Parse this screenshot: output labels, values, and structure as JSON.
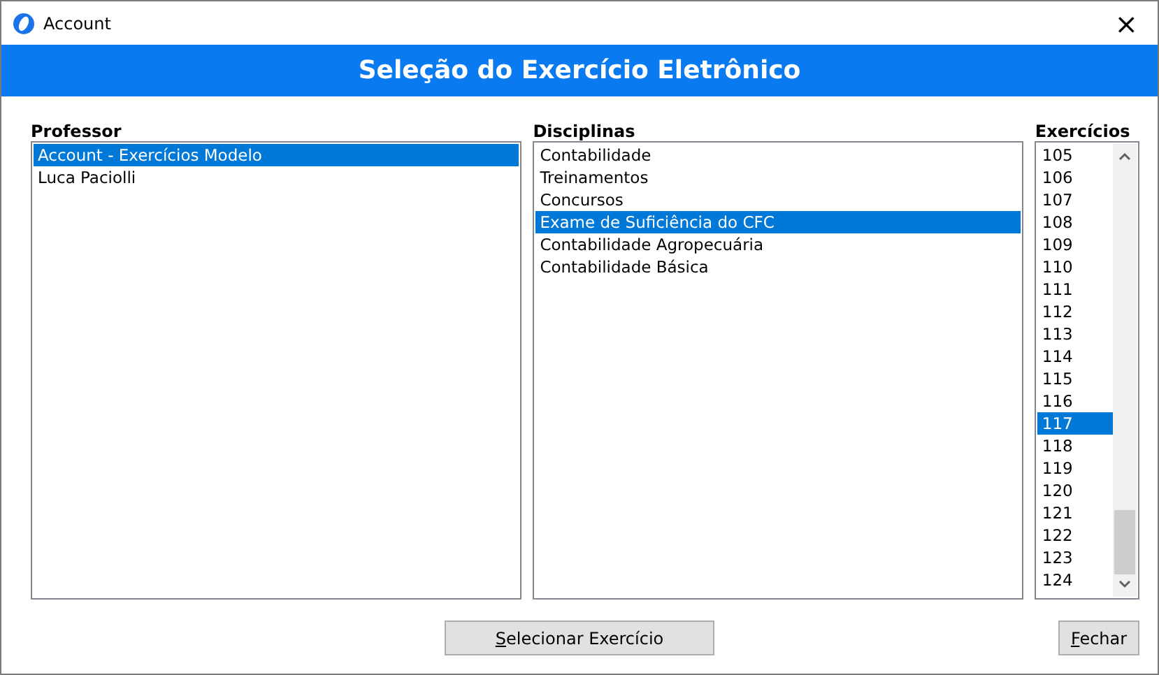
{
  "window": {
    "title": "Account",
    "close": "×"
  },
  "header": {
    "title": "Seleção do Exercício Eletrônico"
  },
  "lists": [
    {
      "label": "Professor",
      "items": [
        {
          "text": "Account - Exercícios Modelo",
          "selected": true
        },
        {
          "text": "Luca Paciolli",
          "selected": false
        }
      ]
    },
    {
      "label": "Disciplinas",
      "items": [
        {
          "text": "Contabilidade",
          "selected": false
        },
        {
          "text": "Treinamentos",
          "selected": false
        },
        {
          "text": "Concursos",
          "selected": false
        },
        {
          "text": "Exame de Suficiência do CFC",
          "selected": true
        },
        {
          "text": "Contabilidade Agropecuária",
          "selected": false
        },
        {
          "text": "Contabilidade Básica",
          "selected": false
        }
      ]
    },
    {
      "label": "Exercícios",
      "scrollable": true,
      "items": [
        {
          "text": "105",
          "selected": false
        },
        {
          "text": "106",
          "selected": false
        },
        {
          "text": "107",
          "selected": false
        },
        {
          "text": "108",
          "selected": false
        },
        {
          "text": "109",
          "selected": false
        },
        {
          "text": "110",
          "selected": false
        },
        {
          "text": "111",
          "selected": false
        },
        {
          "text": "112",
          "selected": false
        },
        {
          "text": "113",
          "selected": false
        },
        {
          "text": "114",
          "selected": false
        },
        {
          "text": "115",
          "selected": false
        },
        {
          "text": "116",
          "selected": false
        },
        {
          "text": "117",
          "selected": true
        },
        {
          "text": "118",
          "selected": false
        },
        {
          "text": "119",
          "selected": false
        },
        {
          "text": "120",
          "selected": false
        },
        {
          "text": "121",
          "selected": false
        },
        {
          "text": "122",
          "selected": false
        },
        {
          "text": "123",
          "selected": false
        },
        {
          "text": "124",
          "selected": false
        }
      ]
    }
  ],
  "buttons": [
    {
      "label": "Selecionar Exercício",
      "first_letter_underlined": true
    },
    {
      "label": "Fechar",
      "first_letter_underlined": true
    }
  ]
}
